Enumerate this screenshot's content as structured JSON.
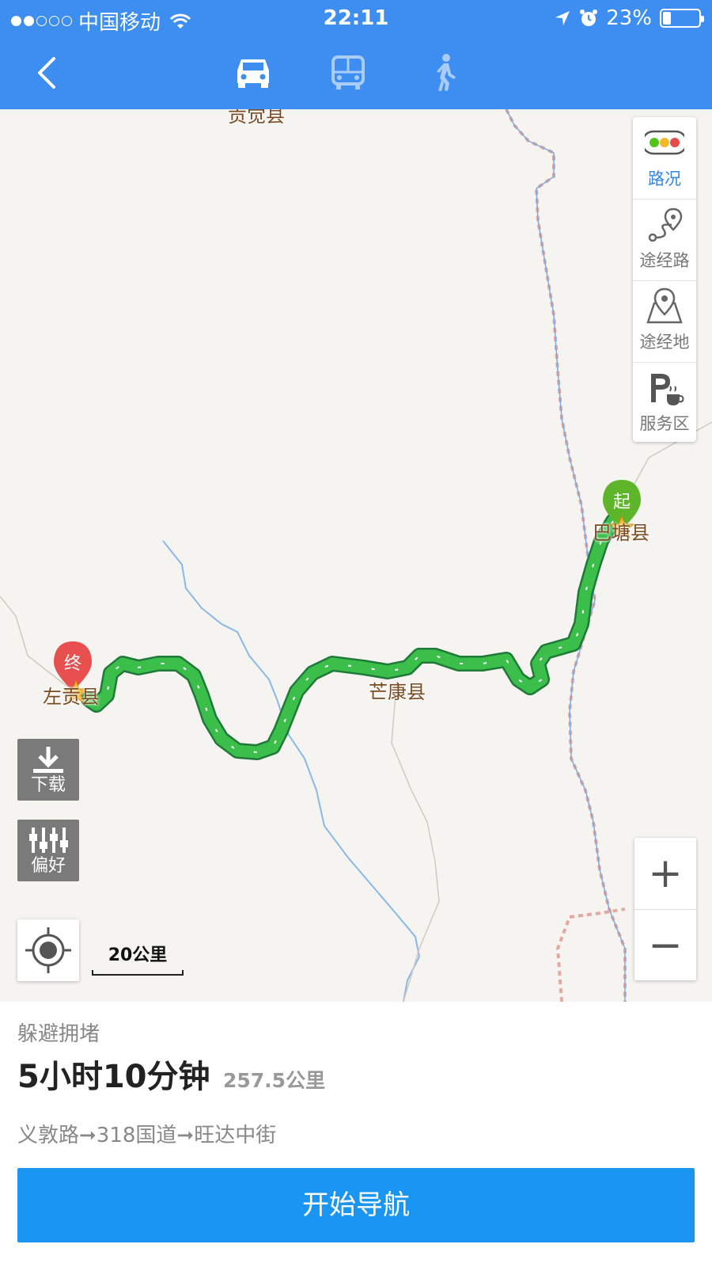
{
  "status_bar": {
    "carrier": "中国移动",
    "time": "22:11",
    "battery": "23%",
    "battery_level": 0.23
  },
  "header": {
    "back_icon": "chevron-left-icon",
    "modes": [
      {
        "name": "car",
        "icon": "car-icon",
        "selected": true
      },
      {
        "name": "bus",
        "icon": "bus-icon",
        "selected": false
      },
      {
        "name": "walk",
        "icon": "walk-icon",
        "selected": false
      }
    ],
    "bg_color": "#3d8ef0"
  },
  "map": {
    "places": {
      "top": "贡觉县",
      "start": "巴塘县",
      "middle": "芒康县",
      "end": "左贡县"
    },
    "start_marker": "起",
    "end_marker": "终",
    "tools": [
      {
        "label": "路况",
        "icon": "traffic-light-icon"
      },
      {
        "label": "途经路",
        "icon": "route-pin-icon"
      },
      {
        "label": "途经地",
        "icon": "map-pin-icon"
      },
      {
        "label": "服务区",
        "icon": "parking-coffee-icon"
      }
    ],
    "download_label": "下载",
    "preference_label": "偏好",
    "scale_label": "20公里",
    "zoom_in": "+",
    "zoom_out": "−",
    "route_color": "#3cbf4a"
  },
  "summary": {
    "tag": "躲避拥堵",
    "duration": "5小时10分钟",
    "distance": "257.5公里",
    "via": "义敦路➞318国道➞旺达中街",
    "start_button": "开始导航",
    "button_color": "#1a96f2"
  }
}
